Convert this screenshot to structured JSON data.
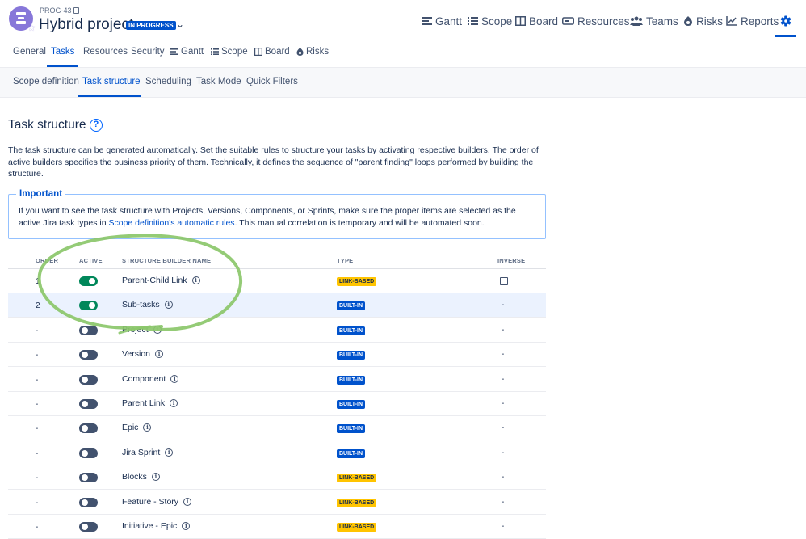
{
  "header": {
    "project_key": "PROG-43",
    "project_name": "Hybrid project",
    "status": "IN PROGRESS",
    "nav": [
      {
        "label": "Gantt",
        "icon": "gantt-icon"
      },
      {
        "label": "Scope",
        "icon": "scope-icon"
      },
      {
        "label": "Board",
        "icon": "board-icon"
      },
      {
        "label": "Resources",
        "icon": "resources-icon"
      },
      {
        "label": "Teams",
        "icon": "teams-icon"
      },
      {
        "label": "Risks",
        "icon": "risks-icon"
      },
      {
        "label": "Reports",
        "icon": "reports-icon"
      }
    ],
    "settings_icon": "gear-icon"
  },
  "tabs": [
    {
      "label": "General"
    },
    {
      "label": "Tasks",
      "active": true
    },
    {
      "label": "Resources"
    },
    {
      "label": "Security"
    },
    {
      "label": "Gantt",
      "icon": "gantt-icon"
    },
    {
      "label": "Scope",
      "icon": "scope-icon"
    },
    {
      "label": "Board",
      "icon": "board-icon"
    },
    {
      "label": "Risks",
      "icon": "risks-icon"
    }
  ],
  "subtabs": [
    {
      "label": "Scope definition"
    },
    {
      "label": "Task structure",
      "active": true
    },
    {
      "label": "Scheduling"
    },
    {
      "label": "Task Mode"
    },
    {
      "label": "Quick Filters"
    }
  ],
  "main": {
    "title": "Task structure",
    "description": "The task structure can be generated automatically. Set the suitable rules to structure your tasks by activating respective builders. The order of active builders specifies the business priority of them. Technically, it defines the sequence of \"parent finding\" loops performed by building the structure.",
    "important": {
      "title": "Important",
      "text_before": "If you want to see the task structure with Projects, Versions, Components, or Sprints, make sure the proper items are selected as the active Jira task types in ",
      "link": "Scope definition's automatic rules",
      "text_after": ". This manual correlation is temporary and will be automated soon."
    }
  },
  "table": {
    "headers": {
      "order": "ORDER",
      "active": "ACTIVE",
      "name": "STRUCTURE BUILDER NAME",
      "type": "TYPE",
      "inverse": "INVERSE"
    },
    "rows": [
      {
        "order": "1",
        "active": true,
        "name": "Parent-Child Link",
        "type": "LINK-BASED",
        "inverse": "checkbox"
      },
      {
        "order": "2",
        "active": true,
        "name": "Sub-tasks",
        "type": "BUILT-IN",
        "inverse": "-"
      },
      {
        "order": "-",
        "active": false,
        "name": "Project",
        "type": "BUILT-IN",
        "inverse": "-"
      },
      {
        "order": "-",
        "active": false,
        "name": "Version",
        "type": "BUILT-IN",
        "inverse": "-"
      },
      {
        "order": "-",
        "active": false,
        "name": "Component",
        "type": "BUILT-IN",
        "inverse": "-"
      },
      {
        "order": "-",
        "active": false,
        "name": "Parent Link",
        "type": "BUILT-IN",
        "inverse": "-"
      },
      {
        "order": "-",
        "active": false,
        "name": "Epic",
        "type": "BUILT-IN",
        "inverse": "-"
      },
      {
        "order": "-",
        "active": false,
        "name": "Jira Sprint",
        "type": "BUILT-IN",
        "inverse": "-"
      },
      {
        "order": "-",
        "active": false,
        "name": "Blocks",
        "type": "LINK-BASED",
        "inverse": "-"
      },
      {
        "order": "-",
        "active": false,
        "name": "Feature - Story",
        "type": "LINK-BASED",
        "inverse": "-"
      },
      {
        "order": "-",
        "active": false,
        "name": "Initiative - Epic",
        "type": "LINK-BASED",
        "inverse": "-"
      }
    ]
  },
  "colors": {
    "accent": "#0052cc",
    "toggle_on": "#00875a",
    "toggle_off": "#42526e",
    "link_based_badge": "#ffc400",
    "annotation_circle": "#8bc76a"
  }
}
